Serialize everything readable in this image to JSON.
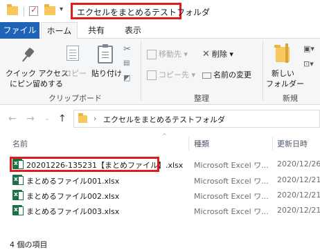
{
  "window": {
    "title": "エクセルをまとめるテストフォルダ"
  },
  "ribbon_tabs": [
    {
      "label": "ファイル"
    },
    {
      "label": "ホーム"
    },
    {
      "label": "共有"
    },
    {
      "label": "表示"
    }
  ],
  "ribbon": {
    "pin_label_1": "クイック アクセス",
    "pin_label_2": "にピン留めする",
    "copy_label": "コピー",
    "paste_label": "貼り付け",
    "move_to_label": "移動先",
    "copy_to_label": "コピー先",
    "delete_label": "削除",
    "rename_label": "名前の変更",
    "new_folder_label_1": "新しい",
    "new_folder_label_2": "フォルダー",
    "groups": {
      "clipboard": "クリップボード",
      "organize": "整理",
      "new": "新規"
    }
  },
  "address": {
    "path": "エクセルをまとめるテストフォルダ"
  },
  "columns": {
    "name": "名前",
    "type": "種類",
    "date": "更新日時"
  },
  "files": [
    {
      "name": "20201226-135231【まとめファイル】.xlsx",
      "type": "Microsoft Excel ワ...",
      "date": "2020/12/26"
    },
    {
      "name": "まとめるファイル001.xlsx",
      "type": "Microsoft Excel ワ...",
      "date": "2020/12/21"
    },
    {
      "name": "まとめるファイル002.xlsx",
      "type": "Microsoft Excel ワ...",
      "date": "2020/12/21"
    },
    {
      "name": "まとめるファイル003.xlsx",
      "type": "Microsoft Excel ワ...",
      "date": "2020/12/21"
    }
  ],
  "status": {
    "item_count": "4 個の項目"
  },
  "colors": {
    "highlight": "#e11b1b",
    "file_tab": "#1e63b6",
    "excel_green": "#1d7044"
  }
}
